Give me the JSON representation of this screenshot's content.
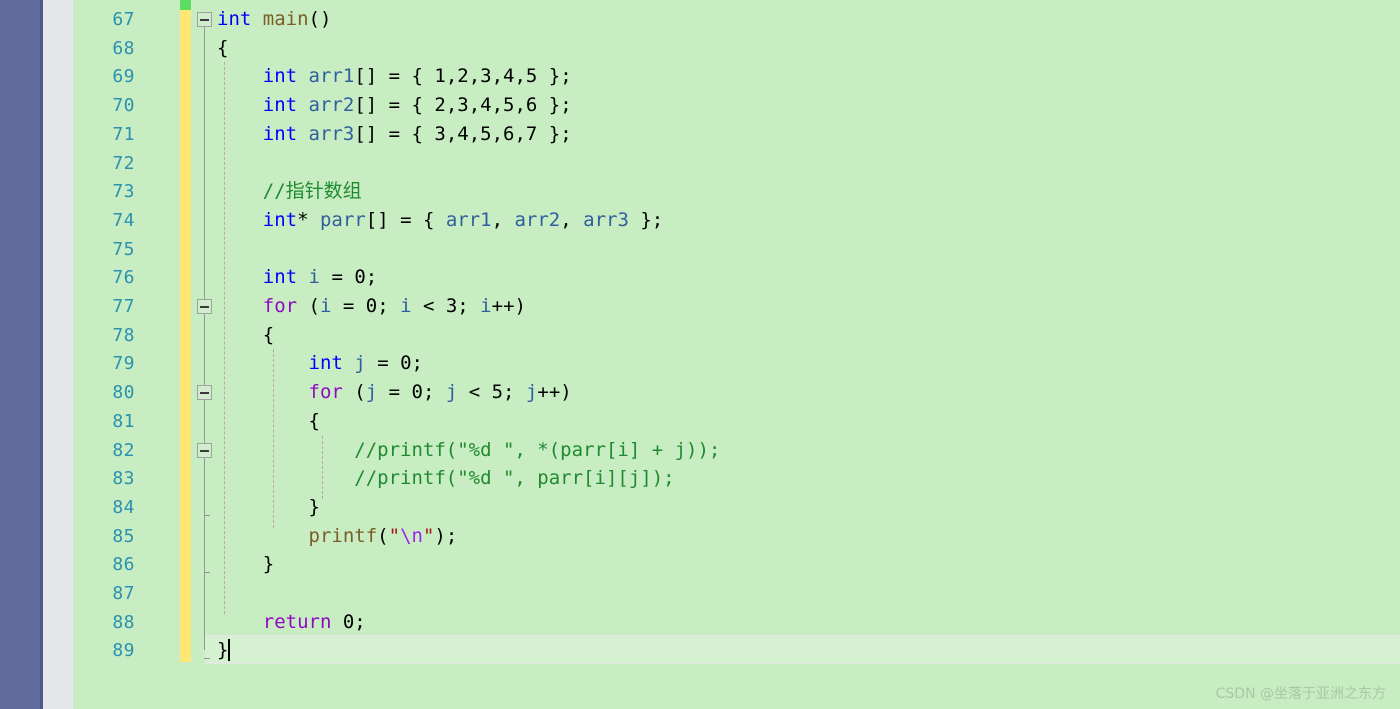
{
  "app": {
    "kind": "code-editor",
    "theme_name": "green-editor-theme",
    "colors": {
      "editor_background": "#c8edc2",
      "current_line_background": "#d6f0d2",
      "left_panel": "#626b9e",
      "left_panel_edge": "#4e5788",
      "gray_band": "#e6e7e8",
      "line_number": "#2b91af",
      "change_bar_unsaved": "#ffe775",
      "change_bar_saved": "#5fdc62",
      "keyword": "#0000ff",
      "control_keyword": "#8f08c4",
      "function": "#795e26",
      "variable": "#2f5f9e",
      "comment": "#1f8a2f",
      "string": "#a31515",
      "escape": "#a020f0",
      "plain": "#000000",
      "outline_line": "#8f998f",
      "indent_guide": "#b9a9a9"
    }
  },
  "gutter": {
    "first_line": 67,
    "last_line": 89,
    "line_numbers": [
      67,
      68,
      69,
      70,
      71,
      72,
      73,
      74,
      75,
      76,
      77,
      78,
      79,
      80,
      81,
      82,
      83,
      84,
      85,
      86,
      87,
      88,
      89
    ]
  },
  "outlining": {
    "fold_icon": "collapse-minus-icon",
    "fold_boxes": [
      {
        "line": 67,
        "label": "−"
      },
      {
        "line": 77,
        "label": "−"
      },
      {
        "line": 80,
        "label": "−"
      },
      {
        "line": 82,
        "label": "−"
      }
    ]
  },
  "editor": {
    "cursor_line": 89,
    "cursor_column": 2,
    "lines": [
      {
        "n": 67,
        "tokens": [
          {
            "t": "int",
            "c": "t-kw"
          },
          {
            "t": " ",
            "c": "t-plain"
          },
          {
            "t": "main",
            "c": "t-fn"
          },
          {
            "t": "()",
            "c": "t-plain"
          }
        ]
      },
      {
        "n": 68,
        "tokens": [
          {
            "t": "{",
            "c": "t-plain"
          }
        ]
      },
      {
        "n": 69,
        "tokens": [
          {
            "t": "    ",
            "c": "t-plain"
          },
          {
            "t": "int",
            "c": "t-kw"
          },
          {
            "t": " ",
            "c": "t-plain"
          },
          {
            "t": "arr1",
            "c": "t-var"
          },
          {
            "t": "[] = { 1,2,3,4,5 };",
            "c": "t-plain"
          }
        ]
      },
      {
        "n": 70,
        "tokens": [
          {
            "t": "    ",
            "c": "t-plain"
          },
          {
            "t": "int",
            "c": "t-kw"
          },
          {
            "t": " ",
            "c": "t-plain"
          },
          {
            "t": "arr2",
            "c": "t-var"
          },
          {
            "t": "[] = { 2,3,4,5,6 };",
            "c": "t-plain"
          }
        ]
      },
      {
        "n": 71,
        "tokens": [
          {
            "t": "    ",
            "c": "t-plain"
          },
          {
            "t": "int",
            "c": "t-kw"
          },
          {
            "t": " ",
            "c": "t-plain"
          },
          {
            "t": "arr3",
            "c": "t-var"
          },
          {
            "t": "[] = { 3,4,5,6,7 };",
            "c": "t-plain"
          }
        ]
      },
      {
        "n": 72,
        "tokens": []
      },
      {
        "n": 73,
        "tokens": [
          {
            "t": "    ",
            "c": "t-plain"
          },
          {
            "t": "//指针数组",
            "c": "t-comment"
          }
        ]
      },
      {
        "n": 74,
        "tokens": [
          {
            "t": "    ",
            "c": "t-plain"
          },
          {
            "t": "int",
            "c": "t-kw"
          },
          {
            "t": "* ",
            "c": "t-plain"
          },
          {
            "t": "parr",
            "c": "t-var"
          },
          {
            "t": "[] = { ",
            "c": "t-plain"
          },
          {
            "t": "arr1",
            "c": "t-var"
          },
          {
            "t": ", ",
            "c": "t-plain"
          },
          {
            "t": "arr2",
            "c": "t-var"
          },
          {
            "t": ", ",
            "c": "t-plain"
          },
          {
            "t": "arr3",
            "c": "t-var"
          },
          {
            "t": " };",
            "c": "t-plain"
          }
        ]
      },
      {
        "n": 75,
        "tokens": []
      },
      {
        "n": 76,
        "tokens": [
          {
            "t": "    ",
            "c": "t-plain"
          },
          {
            "t": "int",
            "c": "t-kw"
          },
          {
            "t": " ",
            "c": "t-plain"
          },
          {
            "t": "i",
            "c": "t-var"
          },
          {
            "t": " = 0;",
            "c": "t-plain"
          }
        ]
      },
      {
        "n": 77,
        "tokens": [
          {
            "t": "    ",
            "c": "t-plain"
          },
          {
            "t": "for",
            "c": "t-ctrl"
          },
          {
            "t": " (",
            "c": "t-plain"
          },
          {
            "t": "i",
            "c": "t-var"
          },
          {
            "t": " = 0; ",
            "c": "t-plain"
          },
          {
            "t": "i",
            "c": "t-var"
          },
          {
            "t": " < 3; ",
            "c": "t-plain"
          },
          {
            "t": "i",
            "c": "t-var"
          },
          {
            "t": "++)",
            "c": "t-plain"
          }
        ]
      },
      {
        "n": 78,
        "tokens": [
          {
            "t": "    {",
            "c": "t-plain"
          }
        ]
      },
      {
        "n": 79,
        "tokens": [
          {
            "t": "        ",
            "c": "t-plain"
          },
          {
            "t": "int",
            "c": "t-kw"
          },
          {
            "t": " ",
            "c": "t-plain"
          },
          {
            "t": "j",
            "c": "t-var"
          },
          {
            "t": " = 0;",
            "c": "t-plain"
          }
        ]
      },
      {
        "n": 80,
        "tokens": [
          {
            "t": "        ",
            "c": "t-plain"
          },
          {
            "t": "for",
            "c": "t-ctrl"
          },
          {
            "t": " (",
            "c": "t-plain"
          },
          {
            "t": "j",
            "c": "t-var"
          },
          {
            "t": " = 0; ",
            "c": "t-plain"
          },
          {
            "t": "j",
            "c": "t-var"
          },
          {
            "t": " < 5; ",
            "c": "t-plain"
          },
          {
            "t": "j",
            "c": "t-var"
          },
          {
            "t": "++)",
            "c": "t-plain"
          }
        ]
      },
      {
        "n": 81,
        "tokens": [
          {
            "t": "        {",
            "c": "t-plain"
          }
        ]
      },
      {
        "n": 82,
        "tokens": [
          {
            "t": "            ",
            "c": "t-plain"
          },
          {
            "t": "//printf(\"%d \", *(parr[i] + j));",
            "c": "t-comment"
          }
        ]
      },
      {
        "n": 83,
        "tokens": [
          {
            "t": "            ",
            "c": "t-plain"
          },
          {
            "t": "//printf(\"%d \", parr[i][j]);",
            "c": "t-comment"
          }
        ]
      },
      {
        "n": 84,
        "tokens": [
          {
            "t": "        }",
            "c": "t-plain"
          }
        ]
      },
      {
        "n": 85,
        "tokens": [
          {
            "t": "        ",
            "c": "t-plain"
          },
          {
            "t": "printf",
            "c": "t-fn"
          },
          {
            "t": "(",
            "c": "t-plain"
          },
          {
            "t": "\"",
            "c": "t-str"
          },
          {
            "t": "\\n",
            "c": "t-esc"
          },
          {
            "t": "\"",
            "c": "t-str"
          },
          {
            "t": ");",
            "c": "t-plain"
          }
        ]
      },
      {
        "n": 86,
        "tokens": [
          {
            "t": "    }",
            "c": "t-plain"
          }
        ]
      },
      {
        "n": 87,
        "tokens": []
      },
      {
        "n": 88,
        "tokens": [
          {
            "t": "    ",
            "c": "t-plain"
          },
          {
            "t": "return",
            "c": "t-ctrl"
          },
          {
            "t": " 0;",
            "c": "t-plain"
          }
        ]
      },
      {
        "n": 89,
        "tokens": [
          {
            "t": "}",
            "c": "t-plain"
          }
        ]
      }
    ]
  },
  "watermark": {
    "text": "CSDN @坐落于亚洲之东方"
  }
}
